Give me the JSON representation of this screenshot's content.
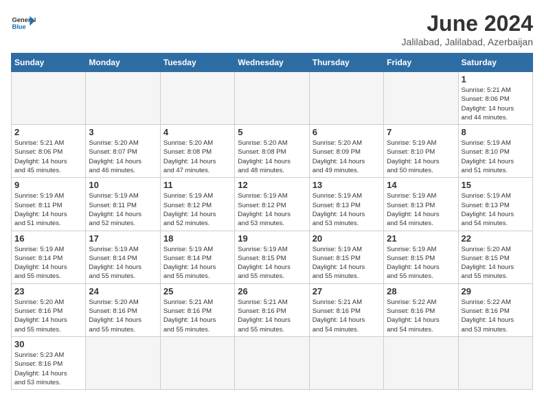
{
  "header": {
    "logo_general": "General",
    "logo_blue": "Blue",
    "month_title": "June 2024",
    "location": "Jalilabad, Jalilabad, Azerbaijan"
  },
  "weekdays": [
    "Sunday",
    "Monday",
    "Tuesday",
    "Wednesday",
    "Thursday",
    "Friday",
    "Saturday"
  ],
  "weeks": [
    [
      {
        "day": "",
        "info": ""
      },
      {
        "day": "",
        "info": ""
      },
      {
        "day": "",
        "info": ""
      },
      {
        "day": "",
        "info": ""
      },
      {
        "day": "",
        "info": ""
      },
      {
        "day": "",
        "info": ""
      },
      {
        "day": "1",
        "info": "Sunrise: 5:21 AM\nSunset: 8:06 PM\nDaylight: 14 hours\nand 44 minutes."
      }
    ],
    [
      {
        "day": "2",
        "info": "Sunrise: 5:21 AM\nSunset: 8:06 PM\nDaylight: 14 hours\nand 45 minutes."
      },
      {
        "day": "3",
        "info": "Sunrise: 5:20 AM\nSunset: 8:07 PM\nDaylight: 14 hours\nand 46 minutes."
      },
      {
        "day": "4",
        "info": "Sunrise: 5:20 AM\nSunset: 8:08 PM\nDaylight: 14 hours\nand 47 minutes."
      },
      {
        "day": "5",
        "info": "Sunrise: 5:20 AM\nSunset: 8:08 PM\nDaylight: 14 hours\nand 48 minutes."
      },
      {
        "day": "6",
        "info": "Sunrise: 5:20 AM\nSunset: 8:09 PM\nDaylight: 14 hours\nand 49 minutes."
      },
      {
        "day": "7",
        "info": "Sunrise: 5:19 AM\nSunset: 8:10 PM\nDaylight: 14 hours\nand 50 minutes."
      },
      {
        "day": "8",
        "info": "Sunrise: 5:19 AM\nSunset: 8:10 PM\nDaylight: 14 hours\nand 51 minutes."
      }
    ],
    [
      {
        "day": "9",
        "info": "Sunrise: 5:19 AM\nSunset: 8:11 PM\nDaylight: 14 hours\nand 51 minutes."
      },
      {
        "day": "10",
        "info": "Sunrise: 5:19 AM\nSunset: 8:11 PM\nDaylight: 14 hours\nand 52 minutes."
      },
      {
        "day": "11",
        "info": "Sunrise: 5:19 AM\nSunset: 8:12 PM\nDaylight: 14 hours\nand 52 minutes."
      },
      {
        "day": "12",
        "info": "Sunrise: 5:19 AM\nSunset: 8:12 PM\nDaylight: 14 hours\nand 53 minutes."
      },
      {
        "day": "13",
        "info": "Sunrise: 5:19 AM\nSunset: 8:13 PM\nDaylight: 14 hours\nand 53 minutes."
      },
      {
        "day": "14",
        "info": "Sunrise: 5:19 AM\nSunset: 8:13 PM\nDaylight: 14 hours\nand 54 minutes."
      },
      {
        "day": "15",
        "info": "Sunrise: 5:19 AM\nSunset: 8:13 PM\nDaylight: 14 hours\nand 54 minutes."
      }
    ],
    [
      {
        "day": "16",
        "info": "Sunrise: 5:19 AM\nSunset: 8:14 PM\nDaylight: 14 hours\nand 55 minutes."
      },
      {
        "day": "17",
        "info": "Sunrise: 5:19 AM\nSunset: 8:14 PM\nDaylight: 14 hours\nand 55 minutes."
      },
      {
        "day": "18",
        "info": "Sunrise: 5:19 AM\nSunset: 8:14 PM\nDaylight: 14 hours\nand 55 minutes."
      },
      {
        "day": "19",
        "info": "Sunrise: 5:19 AM\nSunset: 8:15 PM\nDaylight: 14 hours\nand 55 minutes."
      },
      {
        "day": "20",
        "info": "Sunrise: 5:19 AM\nSunset: 8:15 PM\nDaylight: 14 hours\nand 55 minutes."
      },
      {
        "day": "21",
        "info": "Sunrise: 5:19 AM\nSunset: 8:15 PM\nDaylight: 14 hours\nand 55 minutes."
      },
      {
        "day": "22",
        "info": "Sunrise: 5:20 AM\nSunset: 8:15 PM\nDaylight: 14 hours\nand 55 minutes."
      }
    ],
    [
      {
        "day": "23",
        "info": "Sunrise: 5:20 AM\nSunset: 8:16 PM\nDaylight: 14 hours\nand 55 minutes."
      },
      {
        "day": "24",
        "info": "Sunrise: 5:20 AM\nSunset: 8:16 PM\nDaylight: 14 hours\nand 55 minutes."
      },
      {
        "day": "25",
        "info": "Sunrise: 5:21 AM\nSunset: 8:16 PM\nDaylight: 14 hours\nand 55 minutes."
      },
      {
        "day": "26",
        "info": "Sunrise: 5:21 AM\nSunset: 8:16 PM\nDaylight: 14 hours\nand 55 minutes."
      },
      {
        "day": "27",
        "info": "Sunrise: 5:21 AM\nSunset: 8:16 PM\nDaylight: 14 hours\nand 54 minutes."
      },
      {
        "day": "28",
        "info": "Sunrise: 5:22 AM\nSunset: 8:16 PM\nDaylight: 14 hours\nand 54 minutes."
      },
      {
        "day": "29",
        "info": "Sunrise: 5:22 AM\nSunset: 8:16 PM\nDaylight: 14 hours\nand 53 minutes."
      }
    ],
    [
      {
        "day": "30",
        "info": "Sunrise: 5:23 AM\nSunset: 8:16 PM\nDaylight: 14 hours\nand 53 minutes."
      },
      {
        "day": "",
        "info": ""
      },
      {
        "day": "",
        "info": ""
      },
      {
        "day": "",
        "info": ""
      },
      {
        "day": "",
        "info": ""
      },
      {
        "day": "",
        "info": ""
      },
      {
        "day": "",
        "info": ""
      }
    ]
  ]
}
